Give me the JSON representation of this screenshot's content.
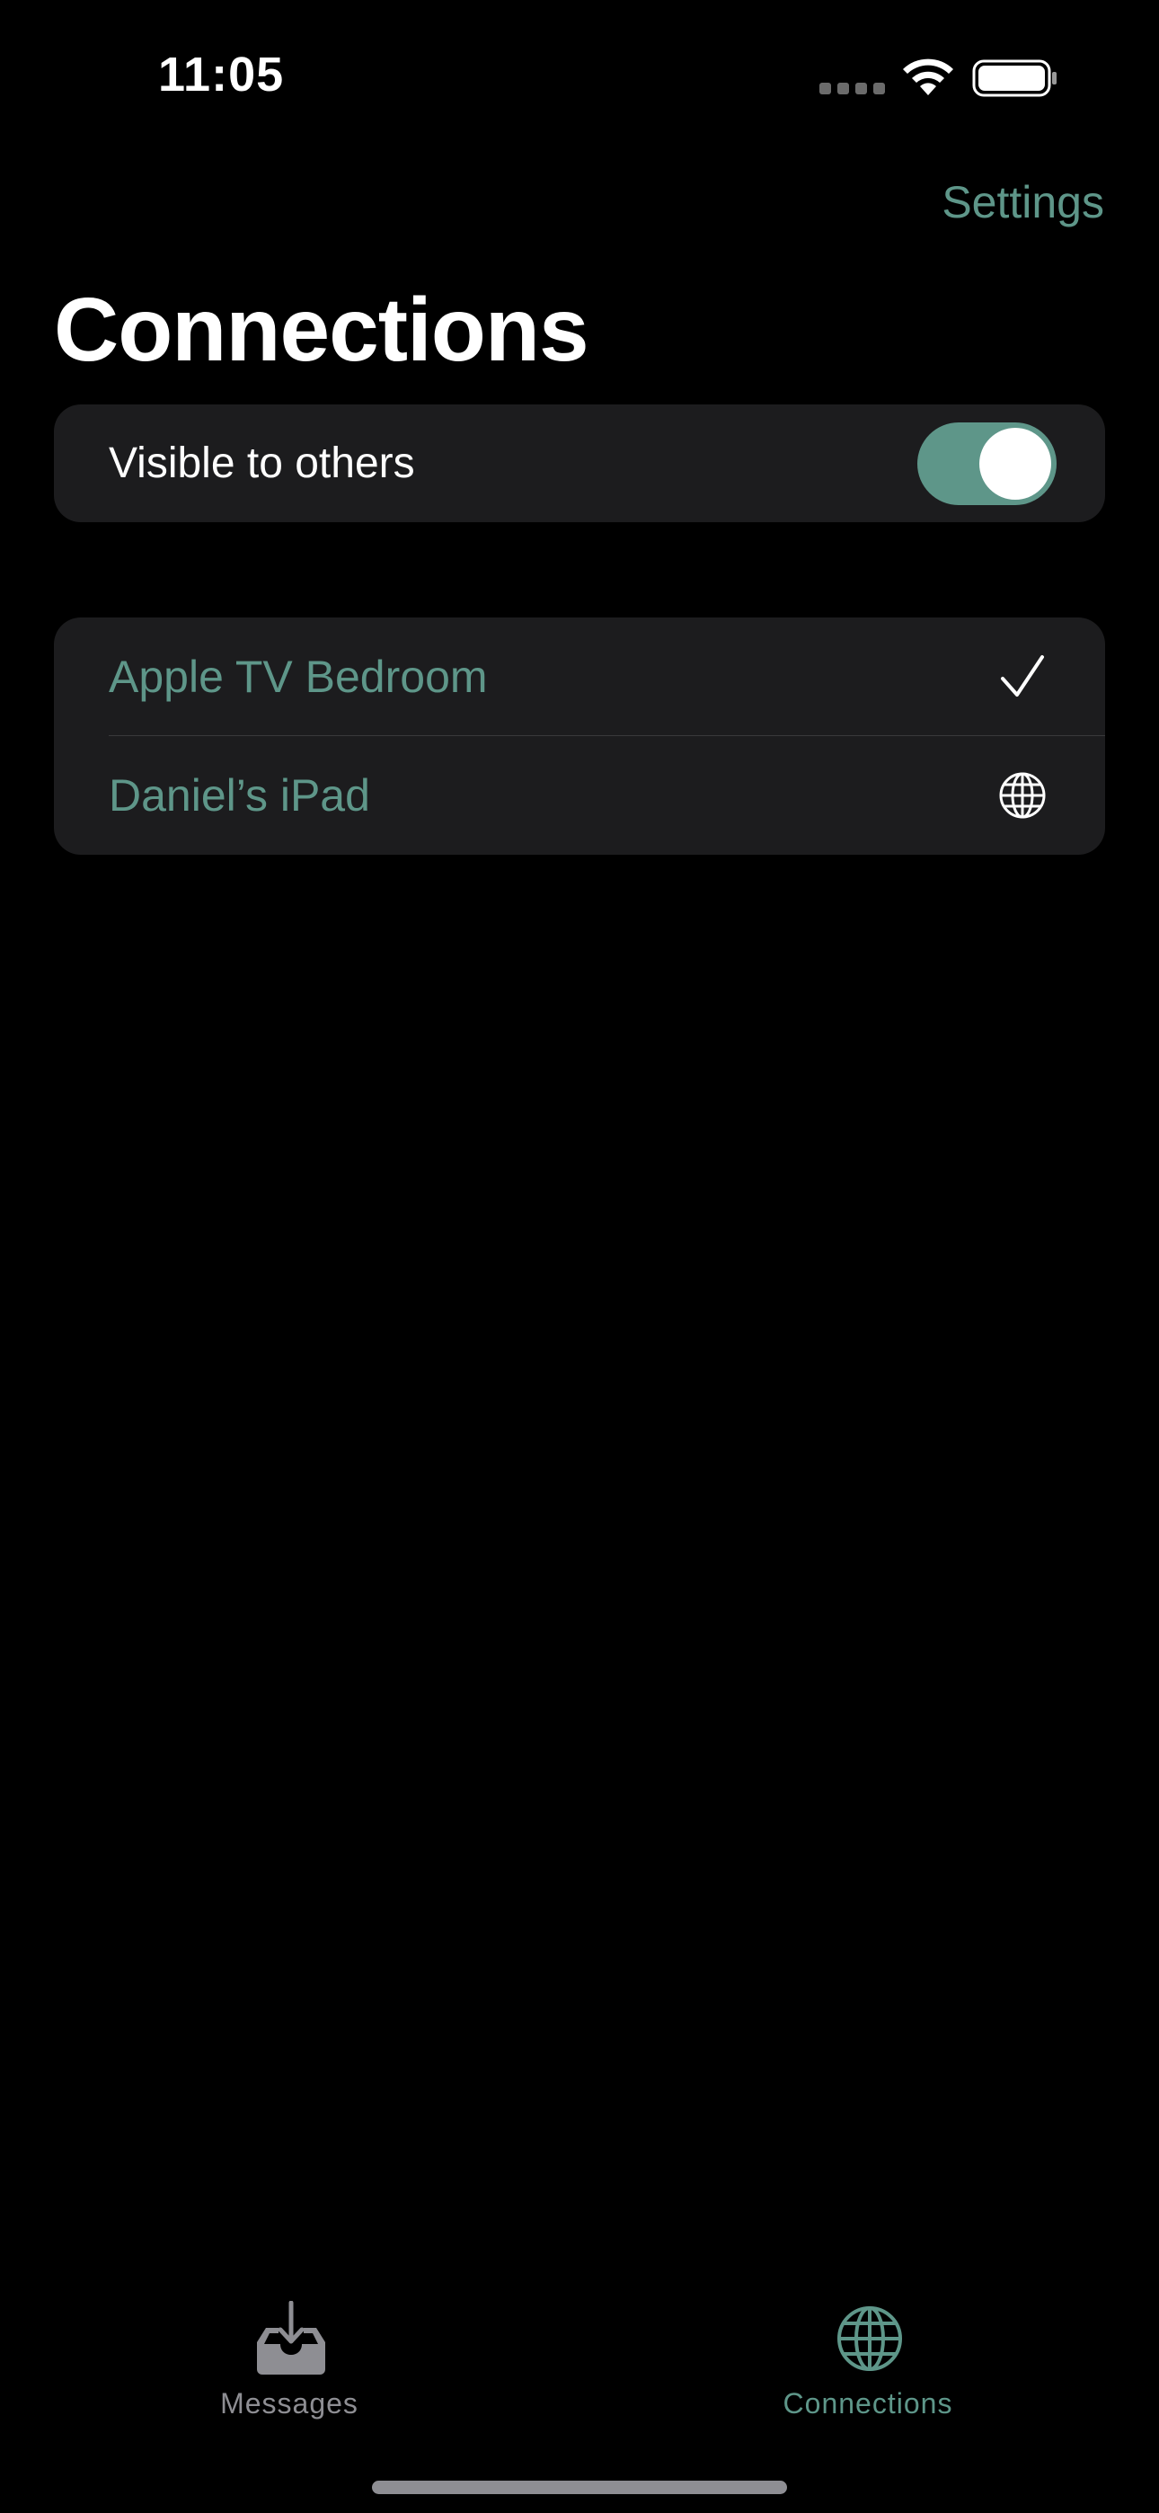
{
  "status_bar": {
    "time": "11:05",
    "icons": [
      "signal-icon",
      "wifi-icon",
      "battery-icon"
    ]
  },
  "nav": {
    "settings_label": "Settings",
    "title": "Connections"
  },
  "visibility": {
    "label": "Visible to others",
    "toggle_on": true
  },
  "devices": [
    {
      "name": "Apple TV Bedroom",
      "icon": "checkmark-icon"
    },
    {
      "name": "Daniel’s iPad",
      "icon": "globe-icon"
    }
  ],
  "tab_bar": {
    "items": [
      {
        "label": "Messages",
        "icon": "inbox-download-icon",
        "selected": false
      },
      {
        "label": "Connections",
        "icon": "globe-icon",
        "selected": true
      }
    ]
  },
  "colors": {
    "accent": "#5e9689",
    "background": "#000000",
    "card": "#1c1c1e",
    "inactive_tab": "#8e8e93"
  }
}
